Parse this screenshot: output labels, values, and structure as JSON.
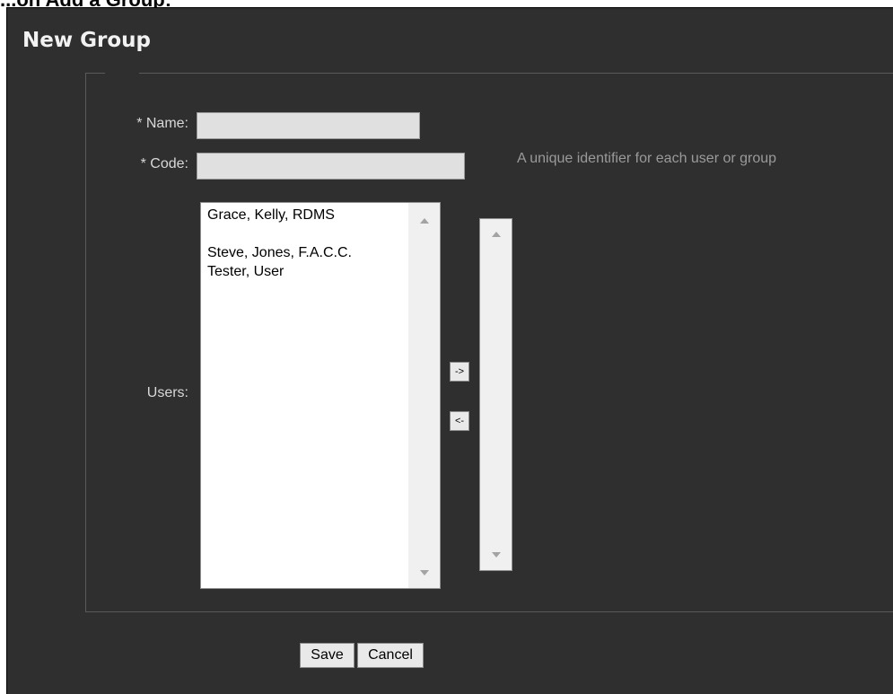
{
  "page": {
    "heading": "...on Add a Group:"
  },
  "dialog": {
    "title": "New Group"
  },
  "form": {
    "name_label": "* Name:",
    "name_value": "",
    "code_label": "* Code:",
    "code_value": "",
    "code_hint": "A unique identifier for each user or group",
    "users_label": "Users:"
  },
  "available_users": [
    "Grace, Kelly, RDMS",
    "",
    "Steve, Jones, F.A.C.C.",
    "Tester, User"
  ],
  "selected_users": [],
  "transfer": {
    "add_label": "->",
    "remove_label": "<-"
  },
  "actions": {
    "save_label": "Save",
    "cancel_label": "Cancel"
  },
  "icons": {
    "scroll_up": "scroll-up-arrow-icon",
    "scroll_down": "scroll-down-arrow-icon"
  },
  "colors": {
    "dialog_background": "#2f2f2f",
    "label_text": "#d8d8d8",
    "hint_text": "#9a9a9a",
    "input_background": "#e0e0e0"
  }
}
